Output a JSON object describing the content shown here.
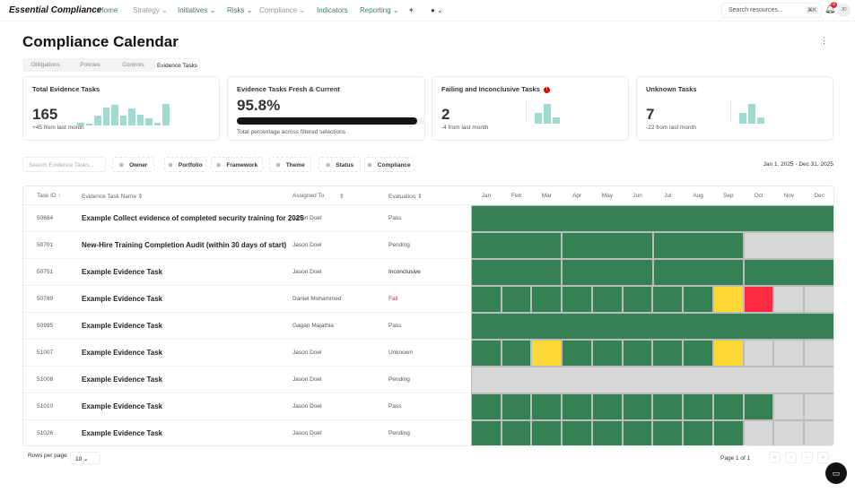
{
  "nav": {
    "brand": "Essential Compliance",
    "items": [
      {
        "label": "Home"
      },
      {
        "label": "Strategy ⌄",
        "muted": true
      },
      {
        "label": "Initiatives ⌄"
      },
      {
        "label": "Risks ⌄"
      },
      {
        "label": "Compliance ⌄",
        "muted": true
      },
      {
        "label": "Indicators"
      },
      {
        "label": "Reporting ⌄"
      }
    ],
    "search_placeholder": "Search resources...",
    "shortcut": "⌘K",
    "notif_count": "9",
    "avatar": "JD"
  },
  "page": {
    "title": "Compliance Calendar",
    "tabs": [
      "Obligations",
      "Policies",
      "Controls",
      "Evidence Tasks"
    ],
    "active_tab": "Evidence Tasks"
  },
  "cards": {
    "total": {
      "title": "Total Evidence Tasks",
      "value": "165",
      "sub": "+45 from last month",
      "spark": [
        3,
        2,
        10,
        18,
        21,
        10,
        17,
        11,
        7,
        3,
        22
      ]
    },
    "fresh": {
      "title": "Evidence Tasks Fresh & Current",
      "value": "95.8%",
      "progress": 95.8,
      "sub": "Total percentage across filtered selections"
    },
    "failing": {
      "title": "Failing and Inconclusive Tasks",
      "alert": "!",
      "value": "2",
      "sub": "-4 from last month",
      "spark": [
        10,
        19,
        6
      ]
    },
    "unknown": {
      "title": "Unknown Tasks",
      "value": "7",
      "sub": "-22 from last month",
      "spark": [
        10,
        19,
        6
      ]
    }
  },
  "filters": {
    "search_placeholder": "Search Evidence Tasks...",
    "buttons": [
      "Owner",
      "Portfolio",
      "Framework",
      "Theme",
      "Status",
      "Compliance"
    ],
    "date_range": "Jan 1, 2025 - Dec 31, 2025"
  },
  "table": {
    "columns": [
      "Task ID ↑",
      "Evidence Task Name ⇕",
      "Assigned To",
      "⇕",
      "Evaluation ⇕"
    ],
    "months": [
      "Jan",
      "Feb",
      "Mar",
      "Apr",
      "May",
      "Jun",
      "Jul",
      "Aug",
      "Sep",
      "Oct",
      "Nov",
      "Dec"
    ],
    "status_colors": {
      "pass": "#358153",
      "pend": "#d7d7d7",
      "warn": "#fdd835",
      "bad": "#ff2b42"
    },
    "rows": [
      {
        "id": "50684",
        "name": "Example Collect evidence of completed security training for 2025",
        "assigned": "Jason Doel",
        "evaluation": "Pass",
        "calendar": [
          [
            12,
            "pass"
          ]
        ]
      },
      {
        "id": "50701",
        "name": "New-Hire Training Completion Audit (within 30 days of start)",
        "assigned": "Jason Doel",
        "evaluation": "Pending",
        "calendar": [
          [
            3,
            "pass"
          ],
          [
            3,
            "pass"
          ],
          [
            3,
            "pass"
          ],
          [
            3,
            "pend"
          ]
        ]
      },
      {
        "id": "50751",
        "name": "Example Evidence Task",
        "assigned": "Jason Doel",
        "evaluation": "Inconclusive",
        "calendar": [
          [
            3,
            "pass"
          ],
          [
            3,
            "pass"
          ],
          [
            3,
            "pass"
          ],
          [
            3,
            "pass"
          ]
        ]
      },
      {
        "id": "50789",
        "name": "Example Evidence Task",
        "assigned": "Daniel Mohammed",
        "evaluation": "Fail",
        "calendar": [
          [
            1,
            "pass"
          ],
          [
            1,
            "pass"
          ],
          [
            1,
            "pass"
          ],
          [
            1,
            "pass"
          ],
          [
            1,
            "pass"
          ],
          [
            1,
            "pass"
          ],
          [
            1,
            "pass"
          ],
          [
            1,
            "pass"
          ],
          [
            1,
            "warn"
          ],
          [
            1,
            "bad"
          ],
          [
            1,
            "pend"
          ],
          [
            1,
            "pend"
          ]
        ]
      },
      {
        "id": "50995",
        "name": "Example Evidence Task",
        "assigned": "Gagan Majathia",
        "evaluation": "Pass",
        "calendar": [
          [
            12,
            "pass"
          ]
        ]
      },
      {
        "id": "51007",
        "name": "Example Evidence Task",
        "assigned": "Jason Doel",
        "evaluation": "Unknown",
        "calendar": [
          [
            1,
            "pass"
          ],
          [
            1,
            "pass"
          ],
          [
            1,
            "warn"
          ],
          [
            1,
            "pass"
          ],
          [
            1,
            "pass"
          ],
          [
            1,
            "pass"
          ],
          [
            1,
            "pass"
          ],
          [
            1,
            "pass"
          ],
          [
            1,
            "warn"
          ],
          [
            1,
            "pend"
          ],
          [
            1,
            "pend"
          ],
          [
            1,
            "pend"
          ]
        ]
      },
      {
        "id": "51008",
        "name": "Example Evidence Task",
        "assigned": "Jason Doel",
        "evaluation": "Pending",
        "calendar": [
          [
            12,
            "pend"
          ]
        ]
      },
      {
        "id": "51010",
        "name": "Example Evidence Task",
        "assigned": "Jason Doel",
        "evaluation": "Pass",
        "calendar": [
          [
            1,
            "pass"
          ],
          [
            1,
            "pass"
          ],
          [
            1,
            "pass"
          ],
          [
            1,
            "pass"
          ],
          [
            1,
            "pass"
          ],
          [
            1,
            "pass"
          ],
          [
            1,
            "pass"
          ],
          [
            1,
            "pass"
          ],
          [
            1,
            "pass"
          ],
          [
            1,
            "pass"
          ],
          [
            1,
            "pend"
          ],
          [
            1,
            "pend"
          ]
        ]
      },
      {
        "id": "51026",
        "name": "Example Evidence Task",
        "assigned": "Jason Doel",
        "evaluation": "Pending",
        "calendar": [
          [
            1,
            "pass"
          ],
          [
            1,
            "pass"
          ],
          [
            1,
            "pass"
          ],
          [
            1,
            "pass"
          ],
          [
            1,
            "pass"
          ],
          [
            1,
            "pass"
          ],
          [
            1,
            "pass"
          ],
          [
            1,
            "pass"
          ],
          [
            1,
            "pass"
          ],
          [
            1,
            "pend"
          ],
          [
            1,
            "pend"
          ],
          [
            1,
            "pend"
          ]
        ]
      }
    ]
  },
  "pagination": {
    "rows_per_page_label": "Rows per page",
    "rows_per_page": "10 ⌄",
    "page_label": "Page 1 of 1",
    "buttons": [
      "«",
      "‹",
      "›",
      "»"
    ]
  }
}
